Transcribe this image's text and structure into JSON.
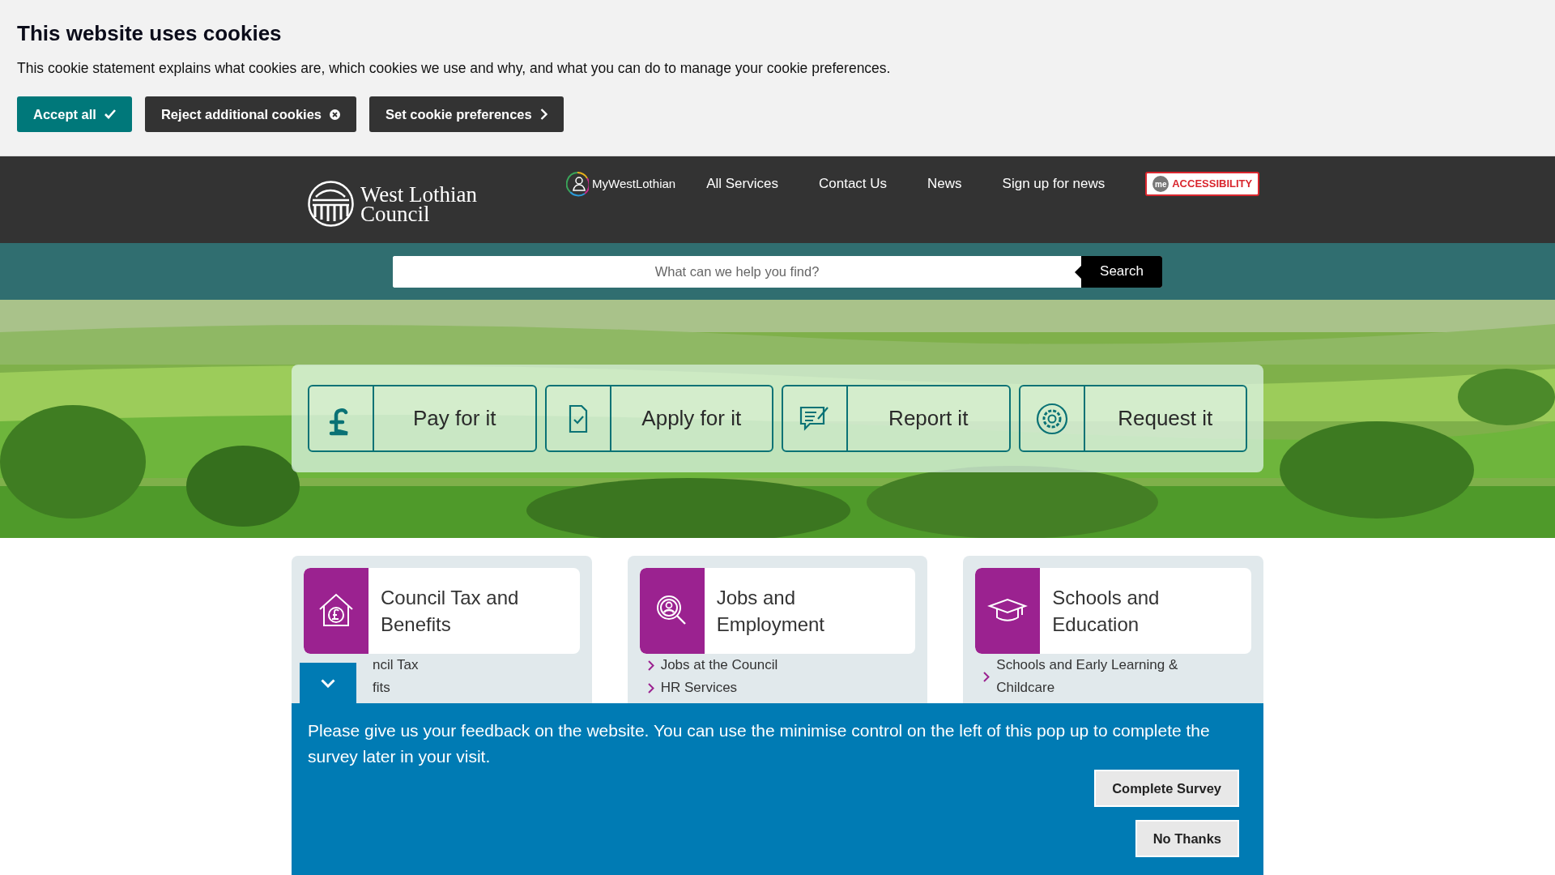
{
  "cookie_banner": {
    "title": "This website uses cookies",
    "text": "This cookie statement explains what cookies are, which cookies we use and why, and what you can do to manage your cookie preferences.",
    "buttons": [
      {
        "label": "Accept all",
        "kind": "accept"
      },
      {
        "label": "Reject additional cookies",
        "kind": "reject"
      },
      {
        "label": "Set cookie preferences",
        "kind": "preferences"
      }
    ]
  },
  "header": {
    "logo": {
      "line1": "West Lothian",
      "line2": "Council"
    },
    "nav": [
      {
        "label": "MyWestLothian",
        "kind": "account"
      },
      {
        "label": "All Services",
        "kind": "link"
      },
      {
        "label": "Contact Us",
        "kind": "link"
      },
      {
        "label": "News",
        "kind": "link"
      },
      {
        "label": "Sign up for news",
        "kind": "link"
      },
      {
        "label": "ACCESSIBILITY",
        "mark": "me",
        "kind": "accessibility"
      }
    ]
  },
  "search": {
    "placeholder": "What can we help you find?",
    "button": "Search"
  },
  "actions": [
    {
      "label": "Pay for it"
    },
    {
      "label": "Apply for it"
    },
    {
      "label": "Report it"
    },
    {
      "label": "Request it"
    }
  ],
  "services": [
    {
      "title": "Council Tax and Benefits",
      "partly_hidden": true,
      "links": [
        "ncil Tax",
        "fits"
      ]
    },
    {
      "title": "Jobs and Employment",
      "partly_hidden": false,
      "links": [
        "Jobs at the Council",
        "HR Services"
      ]
    },
    {
      "title": "Schools and Education",
      "partly_hidden": false,
      "links": [
        "Schools and Early Learning & Childcare"
      ]
    }
  ],
  "feedback": {
    "text": "Please give us your feedback on the website. You can use the minimise control on the left of this pop up to complete the survey later in your visit.",
    "buttons": [
      "Complete Survey",
      "No Thanks"
    ]
  }
}
